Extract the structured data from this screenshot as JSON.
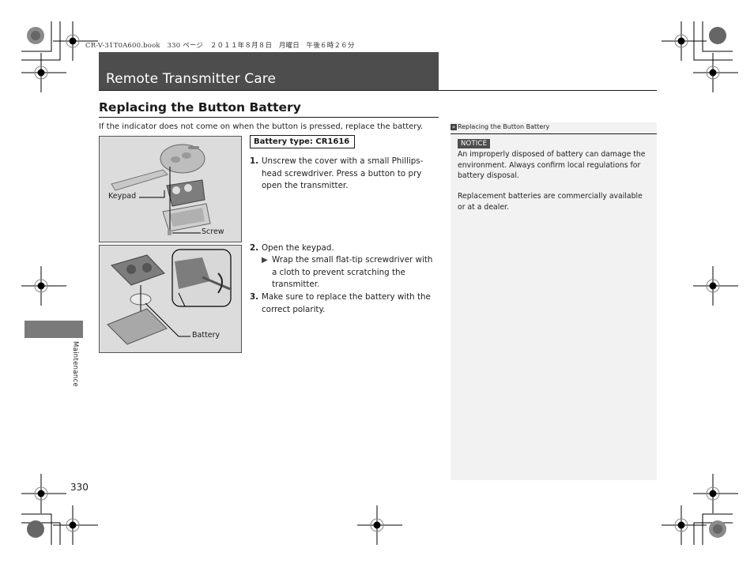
{
  "print_header": "CR-V-31T0A600.book   330 ページ   ２０１１年８月８日   月曜日   午後６時２６分",
  "page": {
    "title": "Remote Transmitter Care",
    "section_heading": "Replacing the Button Battery",
    "intro": "If the indicator does not come on when the button is pressed, replace the battery.",
    "battery_type": "Battery type: CR1616",
    "figures": [
      {
        "name": "keypad-screw-diagram",
        "callouts": [
          "Keypad",
          "Screw"
        ]
      },
      {
        "name": "battery-diagram",
        "callouts": [
          "Battery"
        ]
      }
    ],
    "steps": [
      {
        "number": "1.",
        "text": "Unscrew the cover with a small Phillips-head screwdriver. Press a button to pry open the transmitter."
      },
      {
        "number": "2.",
        "text": "Open the keypad.",
        "substep": {
          "icon": "triangle-bullet-icon",
          "text": "Wrap the small flat-tip screwdriver with a cloth to prevent scratching the transmitter."
        }
      },
      {
        "number": "3.",
        "text": "Make sure to replace the battery with the correct polarity."
      }
    ]
  },
  "sidebar_note": {
    "header_icon": "double-chevron-icon",
    "header": "Replacing the Button Battery",
    "notice_label": "NOTICE",
    "paragraphs": [
      "An improperly disposed of battery can damage the environment. Always confirm local regulations for battery disposal.",
      "Replacement batteries are commercially available or at a dealer."
    ]
  },
  "chapter_label": "Maintenance",
  "page_number": "330",
  "colors": {
    "title_bar": "#4d4d4d",
    "chapter_tab": "#7a7a7a",
    "note_panel": "#f2f2f2",
    "notice_badge": "#4d4d4d"
  }
}
